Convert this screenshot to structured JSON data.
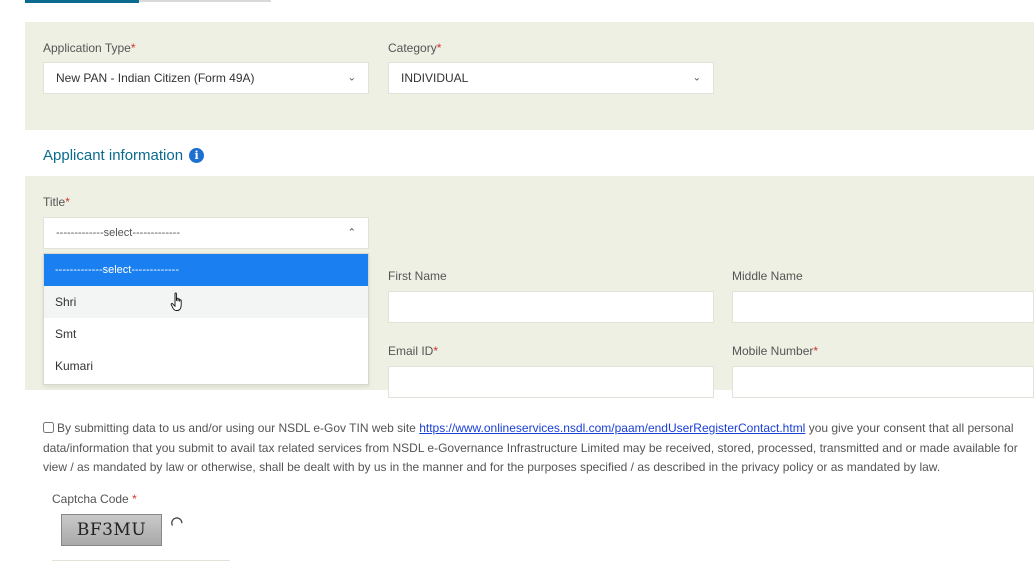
{
  "application": {
    "type_label": "Application Type",
    "type_value": "New PAN - Indian Citizen (Form 49A)",
    "category_label": "Category",
    "category_value": "INDIVIDUAL"
  },
  "applicant": {
    "section_title": "Applicant information",
    "title_label": "Title",
    "title_placeholder": "-------------select-------------",
    "title_options": [
      "-------------select-------------",
      "Shri",
      "Smt",
      "Kumari"
    ],
    "first_name_label": "First Name",
    "middle_name_label": "Middle Name",
    "email_label": "Email ID",
    "mobile_label": "Mobile Number"
  },
  "consent": {
    "text_before": "By submitting data to us and/or using our NSDL e-Gov TIN web site ",
    "link": "https://www.onlineservices.nsdl.com/paam/endUserRegisterContact.html",
    "text_after": " you give your consent that all personal data/information that you submit to avail tax related services from NSDL e-Governance Infrastructure Limited may be received, stored, processed, transmitted and or made available for view / as mandated by law or otherwise, shall be dealt with by us in the manner and for the purposes specified / as described in the privacy policy or as mandated by law."
  },
  "captcha": {
    "label": "Captcha Code",
    "code": "BF3MU"
  },
  "required_marker": "*",
  "icons": {
    "info": "info-icon",
    "chevron": "chevron-down-icon",
    "refresh": "refresh-icon",
    "cursor": "hand-cursor-icon"
  },
  "colors": {
    "panel_bg": "#eef0e3",
    "section_title": "#0b6b8f",
    "selected_option": "#1a7ff0",
    "link": "#1a3fd6",
    "required": "#d0342c"
  }
}
